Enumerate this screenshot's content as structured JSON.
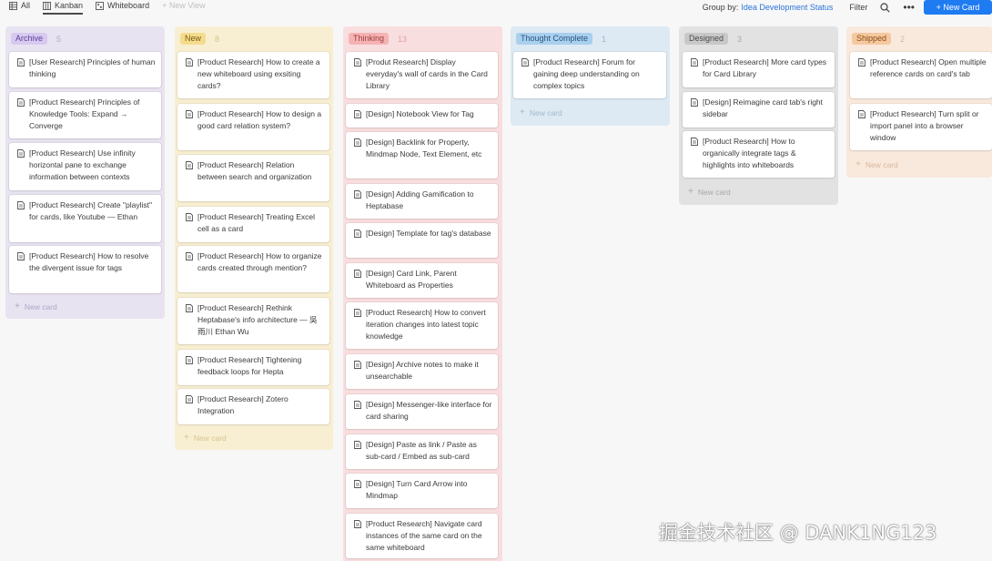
{
  "toolbar": {
    "views": [
      {
        "label": "All",
        "icon": "table-icon"
      },
      {
        "label": "Kanban",
        "icon": "kanban-icon"
      },
      {
        "label": "Whiteboard",
        "icon": "whiteboard-icon"
      }
    ],
    "new_view_label": "+ New View",
    "group_by_label": "Group by:",
    "group_by_value": "Idea Development Status",
    "filter_label": "Filter",
    "more_label": "•••",
    "new_card_label": "+ New Card"
  },
  "colors": {
    "accent": "#1f7bf2",
    "archive": "#e8e3f1",
    "new": "#f8efd2",
    "thinking": "#f9dedf",
    "thought_complete": "#dde9f3",
    "designed": "#e2e2e2",
    "shipped": "#f9e9dc"
  },
  "columns": [
    {
      "name": "Archive",
      "count": "5",
      "cards": [
        "[User Research] Principles of human thinking",
        "[Product Research] Principles of Knowledge Tools: Expand → Converge",
        "[Product Research] Use infinity horizontal pane to exchange information between contexts",
        "[Product Research] Create \"playlist\" for cards, like Youtube — Ethan",
        "[Product Research] How to resolve the divergent issue for tags"
      ],
      "add_label": "New card"
    },
    {
      "name": "New",
      "count": "8",
      "cards": [
        "[Product Research] How to create a new whiteboard using exsiting cards?",
        "[Product Research] How to design a good card relation system?",
        "[Product Research] Relation between search and organization",
        "[Product Research] Treating Excel cell as a card",
        "[Product Research] How to organize cards created through mention?",
        "[Product Research] Rethink Heptabase's info architecture — 吳雨川 Ethan Wu",
        "[Product Research] Tightening feedback loops for Hepta",
        "[Product Research] Zotero Integration"
      ],
      "add_label": "New card"
    },
    {
      "name": "Thinking",
      "count": "13",
      "cards": [
        "[Produt Research] Display everyday's wall of cards in the Card Library",
        "[Design] Notebook View for Tag",
        "[Design] Backlink for Property, Mindmap Node, Text Element, etc",
        "[Design] Adding Gamification to Heptabase",
        "[Design] Template for tag's database",
        "[Design] Card Link, Parent Whiteboard as Properties",
        "[Product Research] How to convert iteration changes into latest topic knowledge",
        "[Design] Archive notes to make it unsearchable",
        "[Design] Messenger-like interface for card sharing",
        "[Design] Paste as link / Paste as sub-card / Embed as sub-card",
        "[Design] Turn Card Arrow into Mindmap",
        "[Product Research] Navigate card instances of the same card on the same whiteboard"
      ]
    },
    {
      "name": "Thought Complete",
      "count": "1",
      "cards": [
        "[Product Research] Forum for gaining deep understanding on complex topics"
      ],
      "add_label": "New card"
    },
    {
      "name": "Designed",
      "count": "3",
      "cards": [
        "[Product Research] More card types for Card Library",
        "[Design] Reimagine card tab's right sidebar",
        "[Product Research] How to organically integrate tags & highlights into whiteboards"
      ],
      "add_label": "New card"
    },
    {
      "name": "Shipped",
      "count": "2",
      "cards": [
        "[Product Research] Open multiple reference cards on card's tab",
        "[Product Research] Turn split or import panel into a browser window"
      ],
      "add_label": "New card"
    }
  ],
  "watermark": "掘金技术社区 @ DANK1NG123"
}
